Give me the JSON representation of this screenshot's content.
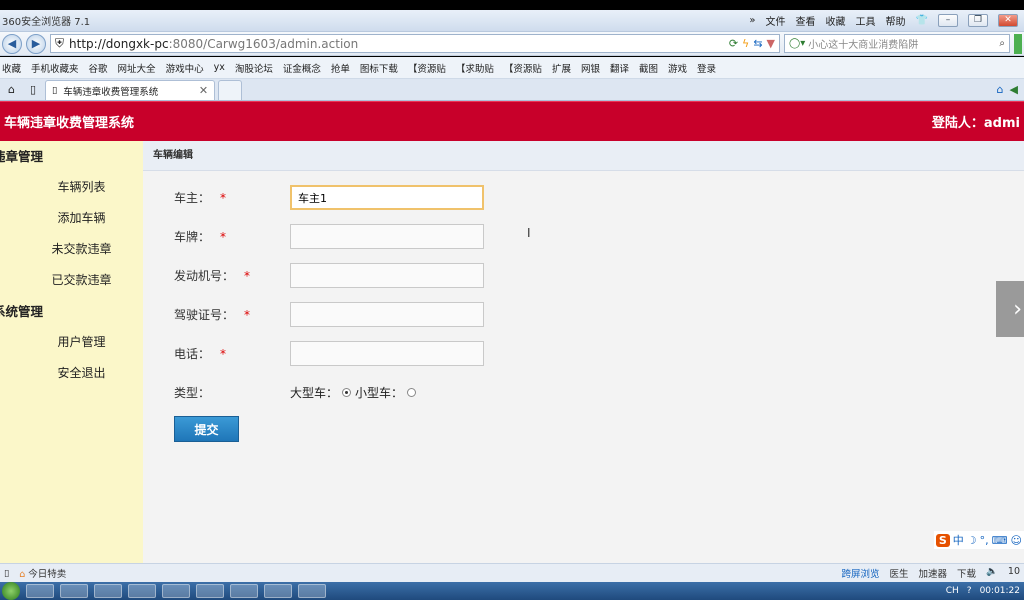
{
  "browser": {
    "title": "360安全浏览器 7.1",
    "menu": [
      "文件",
      "查看",
      "收藏",
      "工具",
      "帮助"
    ],
    "url_host": "http://dongxk-pc",
    "url_rest": ":8080/Carwg1603/admin.action",
    "search_placeholder": "小心这十大商业消费陷阱",
    "bookmarks": [
      "收藏",
      "手机收藏夹",
      "谷歌",
      "网址大全",
      "游戏中心",
      "yx",
      "淘股论坛",
      "证金概念",
      "抢单",
      "图标下载",
      "【资源贴",
      "【求助贴",
      "【资源贴",
      "扩展",
      "网银",
      "翻译",
      "截图",
      "游戏",
      "登录"
    ],
    "tab_title": "车辆违章收费管理系统"
  },
  "app": {
    "title": "车辆违章收费管理系统",
    "login": "登陆人：admi"
  },
  "sidebar": {
    "group1": "违章管理",
    "items1": [
      "车辆列表",
      "添加车辆",
      "未交款违章",
      "已交款违章"
    ],
    "group2": "系统管理",
    "items2": [
      "用户管理",
      "安全退出"
    ]
  },
  "content": {
    "breadcrumb": "车辆编辑",
    "fields": [
      {
        "label": "车主：",
        "value": "车主1",
        "required": "*"
      },
      {
        "label": "车牌：",
        "value": "",
        "required": "*"
      },
      {
        "label": "发动机号：",
        "value": "",
        "required": "*"
      },
      {
        "label": "驾驶证号：",
        "value": "",
        "required": "*"
      },
      {
        "label": "电话：",
        "value": "",
        "required": "*"
      }
    ],
    "type_label": "类型：",
    "type_options": [
      "大型车：",
      "小型车："
    ],
    "selected_type": "大型车：",
    "submit": "提交"
  },
  "statusbar": {
    "left": "今日特卖",
    "right": [
      "跨屏浏览",
      "医生",
      "加速器",
      "下载",
      "10"
    ]
  },
  "taskbar": {
    "time": "00:01:22",
    "lang": "CH"
  }
}
